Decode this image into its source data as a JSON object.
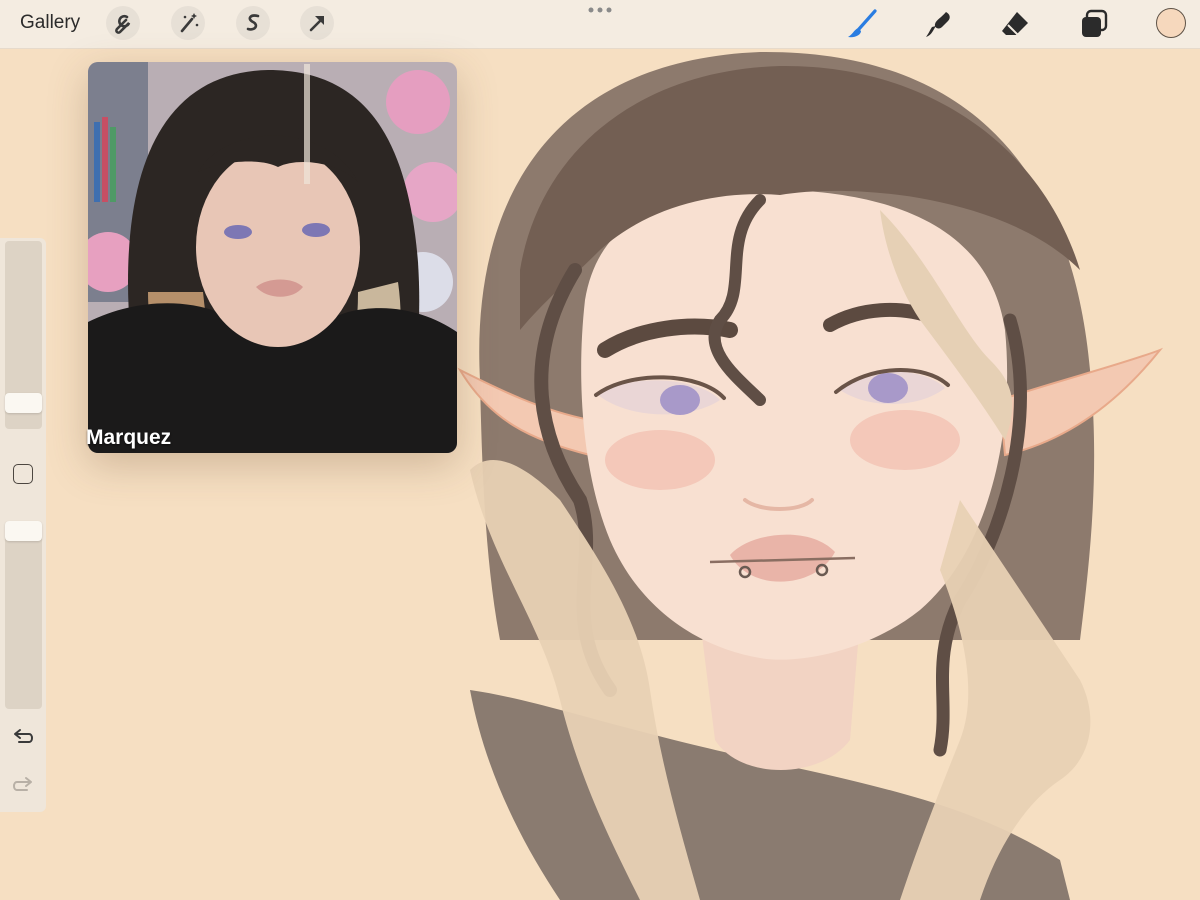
{
  "toolbar": {
    "gallery_label": "Gallery",
    "left_tools": [
      "wrench-icon",
      "magic-wand-icon",
      "selection-icon",
      "transform-arrow-icon"
    ],
    "right_tools": [
      "brush-icon",
      "smudge-icon",
      "eraser-icon",
      "layers-icon"
    ],
    "active_tool": "brush",
    "accent_color": "#2a7de1",
    "current_color": "#f6d8bd"
  },
  "sidebar": {
    "brush_size_fraction": 0.15,
    "opacity_fraction": 0.95
  },
  "reference": {
    "caption": "Marquez"
  }
}
